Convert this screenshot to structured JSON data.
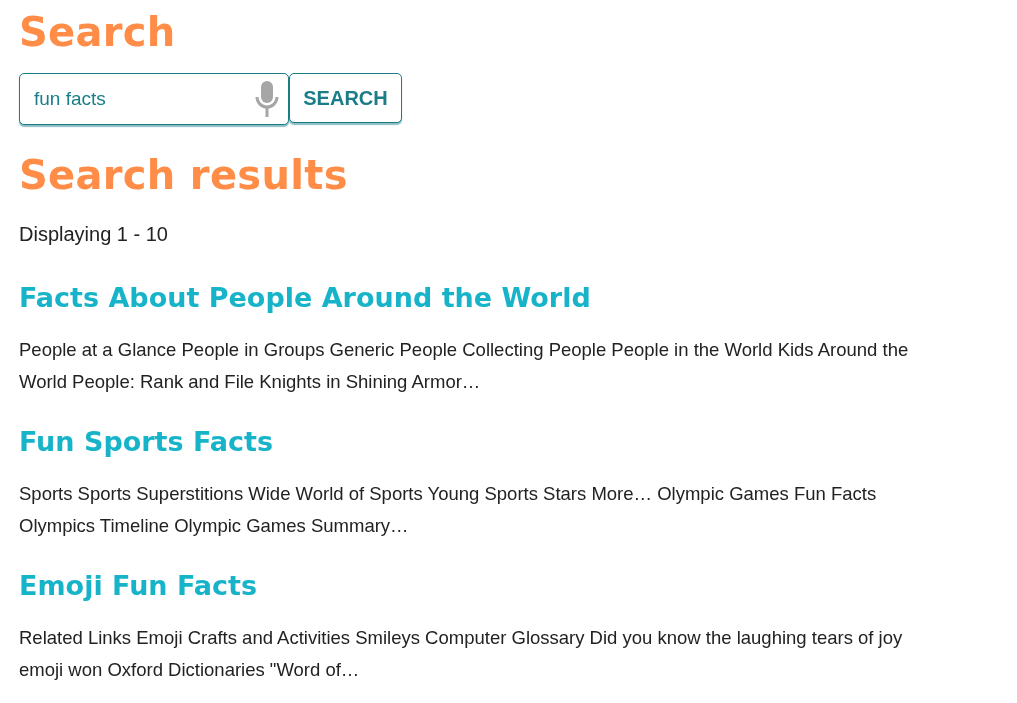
{
  "search_heading": "Search",
  "search": {
    "value": "fun facts",
    "button": "SEARCH"
  },
  "results_heading": "Search results",
  "results_count": "Displaying 1 - 10",
  "results": [
    {
      "title": "Facts About People Around the World",
      "snippet": "People at a Glance People in Groups Generic People Collecting People People in the World Kids Around the World People: Rank and File Knights in Shining Armor…"
    },
    {
      "title": "Fun Sports Facts",
      "snippet": "Sports Sports Superstitions Wide World of Sports Young Sports Stars More… Olympic Games Fun Facts Olympics Timeline Olympic Games Summary…"
    },
    {
      "title": "Emoji Fun Facts",
      "snippet": "Related Links Emoji Crafts and Activities Smileys Computer Glossary Did you know the laughing tears of joy emoji won Oxford Dictionaries \"Word of…"
    }
  ]
}
